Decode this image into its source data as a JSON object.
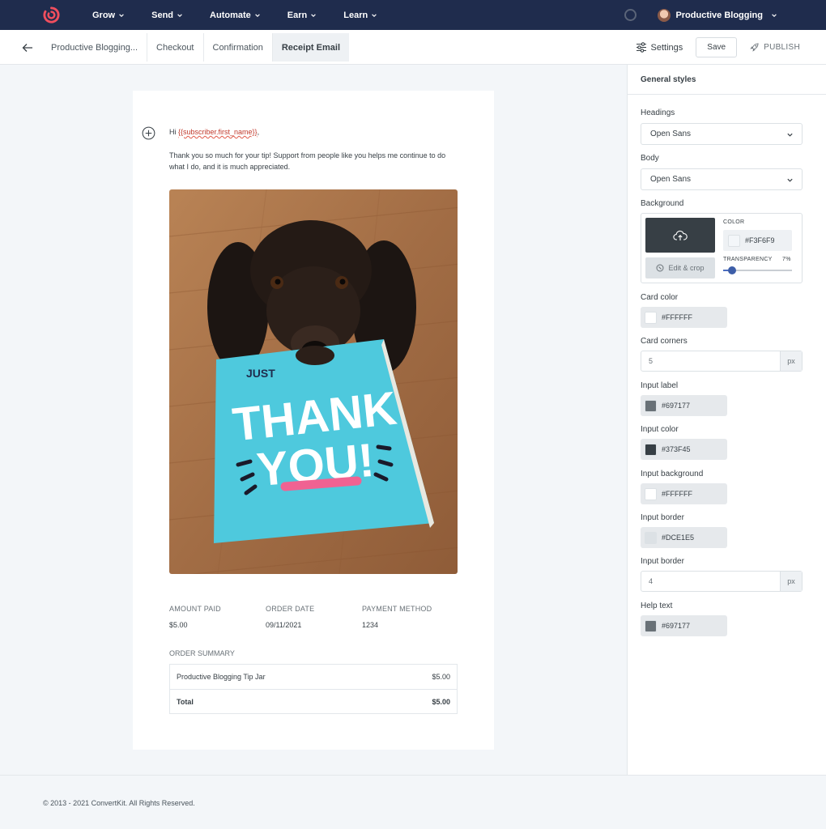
{
  "topnav": {
    "items": [
      {
        "label": "Grow"
      },
      {
        "label": "Send"
      },
      {
        "label": "Automate"
      },
      {
        "label": "Earn"
      },
      {
        "label": "Learn"
      }
    ],
    "account_name": "Productive Blogging"
  },
  "subbar": {
    "tabs": [
      {
        "label": "Productive Blogging..."
      },
      {
        "label": "Checkout"
      },
      {
        "label": "Confirmation"
      },
      {
        "label": "Receipt Email"
      }
    ],
    "active_tab": "Receipt Email",
    "settings_label": "Settings",
    "save_label": "Save",
    "publish_label": "PUBLISH"
  },
  "email": {
    "greeting_prefix": "Hi ",
    "greeting_var": "{{subscriber.first_name}}",
    "greeting_suffix": ",",
    "thanks": "Thank you so much for your tip! Support from people like you helps me continue to do what I do, and it is much appreciated.",
    "card_top_text": "JUST",
    "card_main_1": "THANK",
    "card_main_2": "YOU!",
    "amount_label": "AMOUNT PAID",
    "amount_value": "$5.00",
    "date_label": "ORDER DATE",
    "date_value": "09/11/2021",
    "method_label": "PAYMENT METHOD",
    "method_value": "1234",
    "order_summary_label": "ORDER SUMMARY",
    "order_rows": [
      {
        "item": "Productive Blogging Tip Jar",
        "price": "$5.00"
      },
      {
        "item": "Total",
        "price": "$5.00"
      }
    ]
  },
  "panel": {
    "title": "General styles",
    "headings_label": "Headings",
    "headings_value": "Open Sans",
    "body_label": "Body",
    "body_value": "Open Sans",
    "background_label": "Background",
    "edit_crop": "Edit & crop",
    "color_label": "COLOR",
    "bg_color": "#F3F6F9",
    "transparency_label": "TRANSPARENCY",
    "transparency_value": "7%",
    "transparency_fraction": 0.07,
    "card_color_label": "Card color",
    "card_color": "#FFFFFF",
    "card_corners_label": "Card corners",
    "card_corners": "5",
    "unit_px": "px",
    "input_label_label": "Input label",
    "input_label_color": "#697177",
    "input_color_label": "Input color",
    "input_color": "#373F45",
    "input_bg_label": "Input background",
    "input_bg_color": "#FFFFFF",
    "input_border_label": "Input border",
    "input_border_color": "#DCE1E5",
    "input_border2_label": "Input border",
    "input_border_width": "4",
    "help_text_label": "Help text",
    "help_text_color": "#697177"
  },
  "footer": {
    "copyright": "© 2013 - 2021 ConvertKit. All Rights Reserved."
  },
  "colors": {
    "nav_bg": "#1f2c4d",
    "logo": "#f04e5e",
    "card_blue": "#4ec9dd"
  }
}
